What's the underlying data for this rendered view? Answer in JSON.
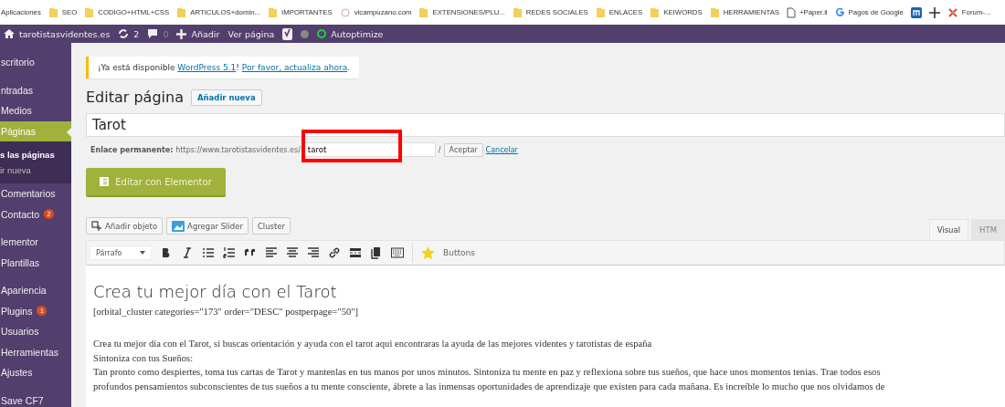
{
  "bookmarks_bar": {
    "items": [
      {
        "kind": "text",
        "label": "Aplicaciones"
      },
      {
        "kind": "folder",
        "label": "SEO"
      },
      {
        "kind": "folder",
        "label": "CODIGO+HTML+CSS"
      },
      {
        "kind": "folder",
        "label": "ARTICULOS+domin..."
      },
      {
        "kind": "folder",
        "label": "IMPORTANTES"
      },
      {
        "kind": "site",
        "label": "vicampuzano.com"
      },
      {
        "kind": "folder",
        "label": "EXTENSIONES/PLU..."
      },
      {
        "kind": "folder",
        "label": "REDES SOCIALES"
      },
      {
        "kind": "folder",
        "label": "ENLACES"
      },
      {
        "kind": "folder",
        "label": "KEIWORDS"
      },
      {
        "kind": "folder",
        "label": "HERRAMIENTAS"
      },
      {
        "kind": "page",
        "label": "+Paper.li"
      },
      {
        "kind": "google",
        "label": "Pagos de Google"
      },
      {
        "kind": "m-logo"
      },
      {
        "kind": "cross"
      },
      {
        "kind": "joomla",
        "label": "Forum-..."
      }
    ]
  },
  "admin_bar": {
    "items": [
      {
        "kind": "home",
        "label": "tarotistasvidentes.es"
      },
      {
        "kind": "updates",
        "label": "2"
      },
      {
        "kind": "comments",
        "label": "0"
      },
      {
        "kind": "add",
        "label": "Añadir"
      },
      {
        "kind": "text",
        "label": "Ver página"
      },
      {
        "kind": "yoast"
      },
      {
        "kind": "dot"
      },
      {
        "kind": "ring",
        "label": "Autoptimize"
      }
    ]
  },
  "sidebar": {
    "groups": [
      [
        {
          "label": "scritorio",
          "selected": false
        }
      ],
      [
        {
          "label": "ntradas",
          "selected": false
        },
        {
          "label": "Medios",
          "selected": false
        },
        {
          "label": "Páginas",
          "selected": true,
          "children": [
            {
              "label": "s las páginas",
              "selected": true
            },
            {
              "label": "ir nueva",
              "selected": false
            }
          ]
        },
        {
          "label": "Comentarios",
          "selected": false
        },
        {
          "label": "Contacto",
          "selected": false,
          "badge": "2"
        }
      ],
      [
        {
          "label": "lementor",
          "selected": false
        },
        {
          "label": "Plantillas",
          "selected": false
        }
      ],
      [
        {
          "label": "Apariencia",
          "selected": false
        },
        {
          "label": "Plugins",
          "selected": false,
          "badge": "1"
        },
        {
          "label": "Usuarios",
          "selected": false
        },
        {
          "label": "Herramientas",
          "selected": false
        },
        {
          "label": "Ajustes",
          "selected": false
        }
      ],
      [
        {
          "label": "Save CF7",
          "selected": false
        }
      ]
    ]
  },
  "notice": {
    "before": "¡Ya está disponible ",
    "link1": "WordPress 5.1",
    "middle": "! ",
    "link2": "Por favor, actualiza ahora",
    "after": "."
  },
  "heading": {
    "title": "Editar página",
    "button": "Añadir nueva"
  },
  "title_field": {
    "value": "Tarot"
  },
  "permalink": {
    "label": "Enlace permanente:",
    "base": "https://www.tarotistasvidentes.es/",
    "slug": "tarot",
    "slash": "/",
    "accept": "Aceptar",
    "cancel": "Cancelar",
    "highlighted": true
  },
  "elementor_button": {
    "label": "Editar con Elementor"
  },
  "media_buttons": [
    {
      "kind": "media",
      "label": "Añadir objeto"
    },
    {
      "kind": "slider",
      "label": "Agregar Slider"
    },
    {
      "kind": "plain",
      "label": "Cluster"
    }
  ],
  "editor_tabs": [
    {
      "label": "Visual",
      "selected": true
    },
    {
      "label": "HTM",
      "selected": false
    }
  ],
  "toolbar": {
    "format": "Párrafo",
    "buttons_label": "Buttons"
  },
  "content": {
    "heading": "Crea tu mejor día con el Tarot",
    "shortcode": "[orbital_cluster categories=\"173\" order=\"DESC\" postperpage=\"50\"]",
    "lines": [
      "Crea tu mejor día con el Tarot, si buscas orientación y ayuda con el tarot aqui encontraras la ayuda de las mejores videntes y tarotistas de españa",
      "Sintoniza con tus Sueños:",
      "Tan pronto como despiertes, toma tus cartas de Tarot y mantenlas en tus manos por unos minutos. Sintoniza tu mente en paz y reflexiona sobre tus sueños, que hace unos momentos tenias. Trae todos esos",
      "profundos pensamientos subconscientes de tus sueños a tu mente consciente, ábrete a las inmensas oportunidades de aprendizaje que existen para cada mañana. Es increíble lo mucho que nos olvidamos de"
    ]
  }
}
